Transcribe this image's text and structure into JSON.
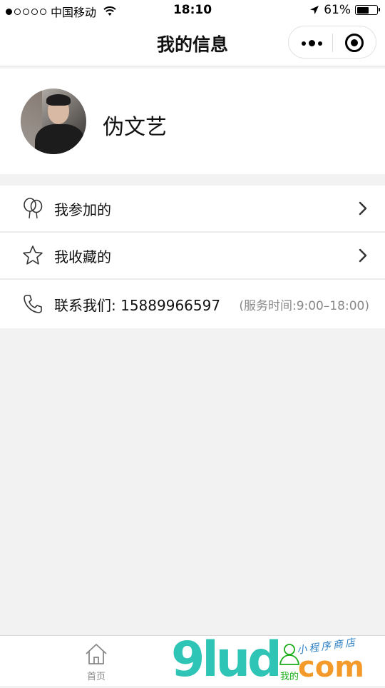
{
  "status_bar": {
    "carrier": "中国移动",
    "time": "18:10",
    "battery_percent": "61%",
    "battery_level": 0.61,
    "signal_dots_filled": 1,
    "icons": [
      "wifi-icon",
      "location-arrow-icon",
      "battery-icon"
    ]
  },
  "nav": {
    "title": "我的信息",
    "more_icon": "more-dots-icon",
    "close_icon": "target-close-icon"
  },
  "profile": {
    "username": "伪文艺",
    "avatar_icon": "avatar-photo"
  },
  "menu": {
    "items": [
      {
        "label": "我参加的",
        "icon": "balloons-icon",
        "hint": ""
      },
      {
        "label": "我收藏的",
        "icon": "star-icon",
        "hint": ""
      },
      {
        "label": "联系我们: 15889966597",
        "icon": "phone-icon",
        "hint": "(服务时间:9:00–18:00)"
      }
    ]
  },
  "tab_bar": {
    "tabs": [
      {
        "label": "首页",
        "icon": "home-icon",
        "active": false
      },
      {
        "label": "我的",
        "icon": "person-icon",
        "active": true
      }
    ],
    "active_color": "#1aad19",
    "inactive_color": "#888888"
  },
  "watermark": {
    "brand": "9lud",
    "domain_suffix": "com",
    "tagline": "小程序商店"
  }
}
